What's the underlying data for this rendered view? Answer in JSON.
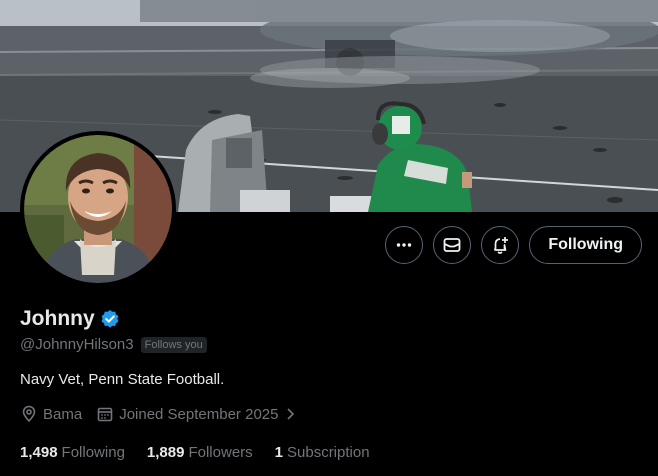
{
  "profile": {
    "name": "Johnny",
    "verified": true,
    "handle": "@JohnnyHilson3",
    "follows_you_badge": "Follows you",
    "bio": "Navy Vet, Penn State Football.",
    "location": "Bama",
    "joined": "Joined September 2025"
  },
  "actions": {
    "more_icon": "more-horizontal-icon",
    "message_icon": "envelope-icon",
    "notify_icon": "bell-plus-icon",
    "following_label": "Following"
  },
  "stats": {
    "following_count": "1,498",
    "following_label": "Following",
    "followers_count": "1,889",
    "followers_label": "Followers",
    "subscription_count": "1",
    "subscription_label": "Subscription"
  },
  "colors": {
    "background": "#000000",
    "primary_text": "#e7e9ea",
    "secondary_text": "#71767b",
    "verified_badge": "#1d9bf0",
    "button_border": "#536471"
  }
}
